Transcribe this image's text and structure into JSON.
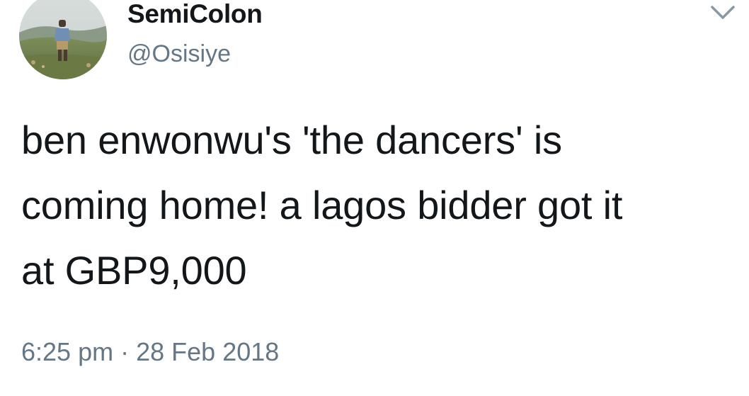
{
  "author": {
    "name": "SemiColon",
    "handle": "@Osisiye"
  },
  "tweet": {
    "lines": [
      "ben enwonwu's 'the dancers' is",
      "coming home! a lagos bidder got it",
      "at GBP9,000"
    ],
    "time": "6:25 pm",
    "separator": "·",
    "date": "28 Feb 2018"
  },
  "icons": {
    "menu": "chevron-down-icon",
    "avatar": "profile-photo"
  },
  "colors": {
    "text": "#14171a",
    "secondary": "#657786",
    "background": "#ffffff"
  }
}
